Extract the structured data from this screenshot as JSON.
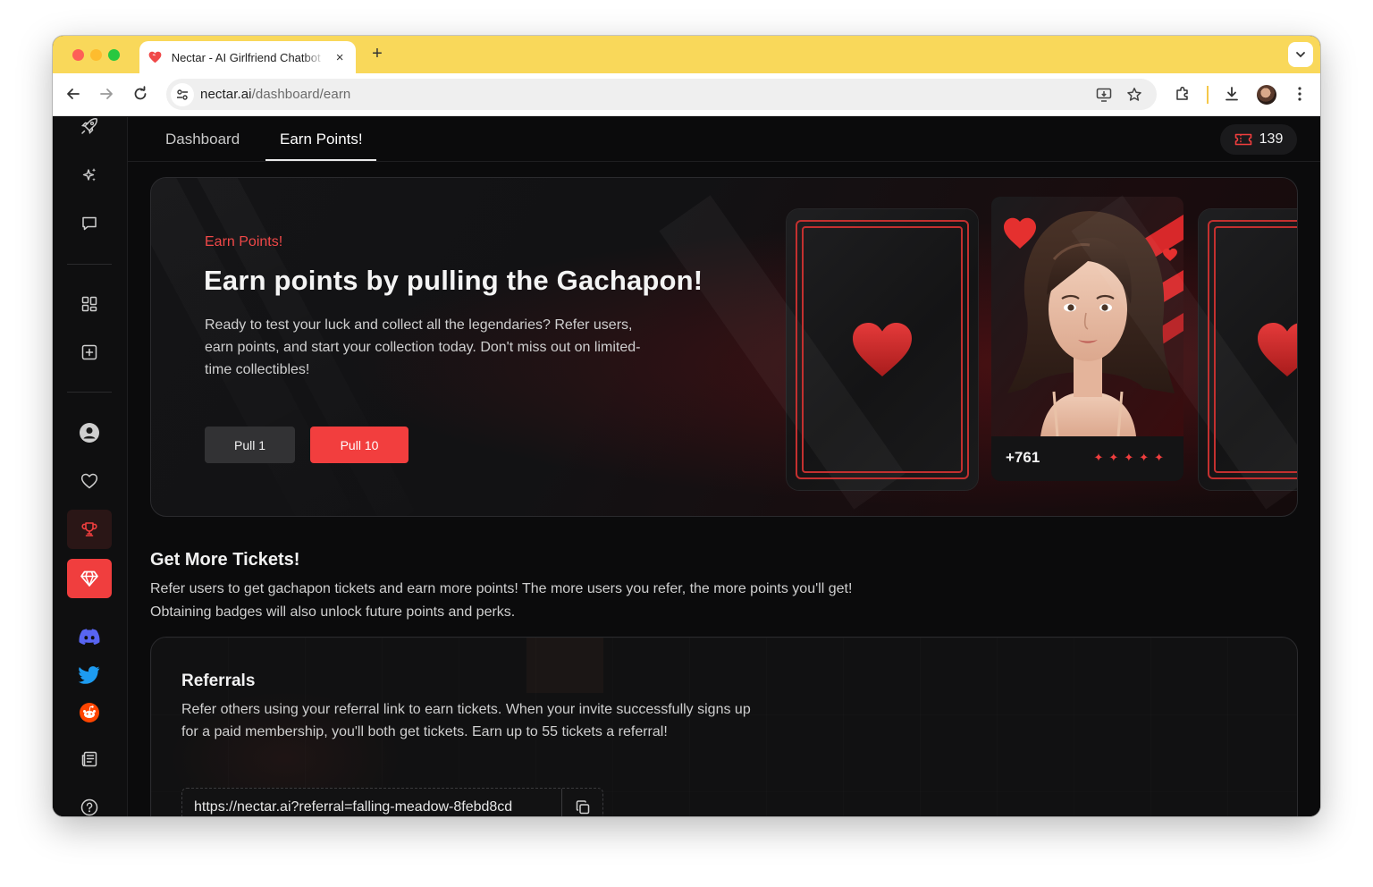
{
  "browser": {
    "tab_title": "Nectar - AI Girlfriend Chatbot",
    "new_tab_label": "+",
    "close_label": "×",
    "url_host": "nectar.ai",
    "url_path": "/dashboard/earn",
    "accent_color": "#f9d85a"
  },
  "nav": {
    "tabs": [
      {
        "label": "Dashboard",
        "active": false
      },
      {
        "label": "Earn Points!",
        "active": true
      }
    ],
    "tickets": "139"
  },
  "sidebar": {
    "items": [
      {
        "icon": "rocket-icon"
      },
      {
        "icon": "sparkles-icon"
      },
      {
        "icon": "chat-icon"
      },
      {
        "icon": "grid-icon"
      },
      {
        "icon": "plus-square-icon"
      },
      {
        "icon": "user-icon"
      },
      {
        "icon": "heart-icon"
      },
      {
        "icon": "trophy-icon",
        "state": "active"
      },
      {
        "icon": "gem-icon",
        "state": "selected"
      },
      {
        "icon": "discord-icon"
      },
      {
        "icon": "twitter-icon"
      },
      {
        "icon": "reddit-icon"
      },
      {
        "icon": "newspaper-icon"
      },
      {
        "icon": "help-icon"
      }
    ]
  },
  "hero": {
    "kicker": "Earn Points!",
    "title": "Earn points by pulling the Gachapon!",
    "description": "Ready to test your luck and collect all the legendaries? Refer users, earn points, and start your collection today. Don't miss out on limited-time collectibles!",
    "pull1_label": "Pull 1",
    "pull10_label": "Pull 10",
    "character_points": "+761",
    "character_stars": "✦✦✦✦✦",
    "brand_color": "#f03e3e"
  },
  "tickets_section": {
    "title": "Get More Tickets!",
    "description": "Refer users to get gachapon tickets and earn more points! The more users you refer, the more points you'll get! Obtaining badges will also unlock future points and perks."
  },
  "referrals": {
    "title": "Referrals",
    "description": "Refer others using your referral link to earn tickets. When your invite successfully signs up for a paid membership, you'll both get tickets. Earn up to 55 tickets a referral!",
    "link": "https://nectar.ai?referral=falling-meadow-8febd8cd"
  }
}
